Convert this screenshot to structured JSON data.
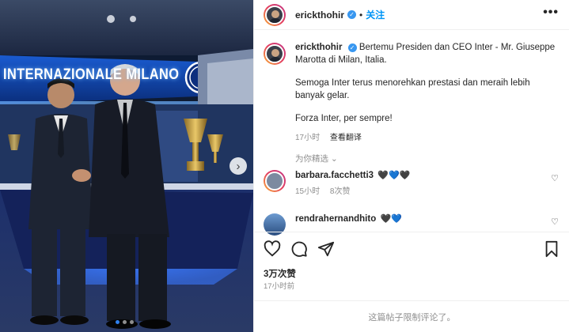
{
  "media": {
    "wall_sign": "INTERNAZIONALE MILANO",
    "carousel_dots": 3,
    "active_dot": 0,
    "next_icon": "chevron-right-icon"
  },
  "header": {
    "username": "erickthohir",
    "verified_icon": "verified-badge-icon",
    "separator": "•",
    "follow_label": "关注",
    "more_icon": "more-horizontal-icon",
    "more_label": "•••"
  },
  "caption": {
    "username": "erickthohir",
    "paragraphs": [
      "Bertemu Presiden dan CEO Inter - Mr. Giuseppe Marotta di Milan, Italia.",
      "Semoga Inter terus menorehkan prestasi dan meraih lebih banyak gelar.",
      "Forza Inter, per sempre!"
    ],
    "time": "17小时",
    "translate_label": "查看翻译"
  },
  "featured": {
    "label": "为你精选",
    "chevron": "⌄"
  },
  "comments": [
    {
      "username": "barbara.facchetti3",
      "text": "🖤💙🖤",
      "time": "15小时",
      "likes": "8次赞"
    },
    {
      "username": "rendrahernandhito",
      "text": "🖤💙",
      "time": "",
      "likes": ""
    }
  ],
  "actions": {
    "like_icon": "heart-outline-icon",
    "comment_icon": "comment-icon",
    "share_icon": "send-icon",
    "save_icon": "bookmark-icon",
    "likes_count": "3万次赞",
    "posted_time": "17小时前"
  },
  "footer": {
    "comments_limited": "这篇帖子限制评论了。"
  },
  "colors": {
    "accent": "#0095f6",
    "text": "#262626",
    "muted": "#8e8e8e",
    "border": "#efefef",
    "inter_blue": "#1a5bbf"
  }
}
